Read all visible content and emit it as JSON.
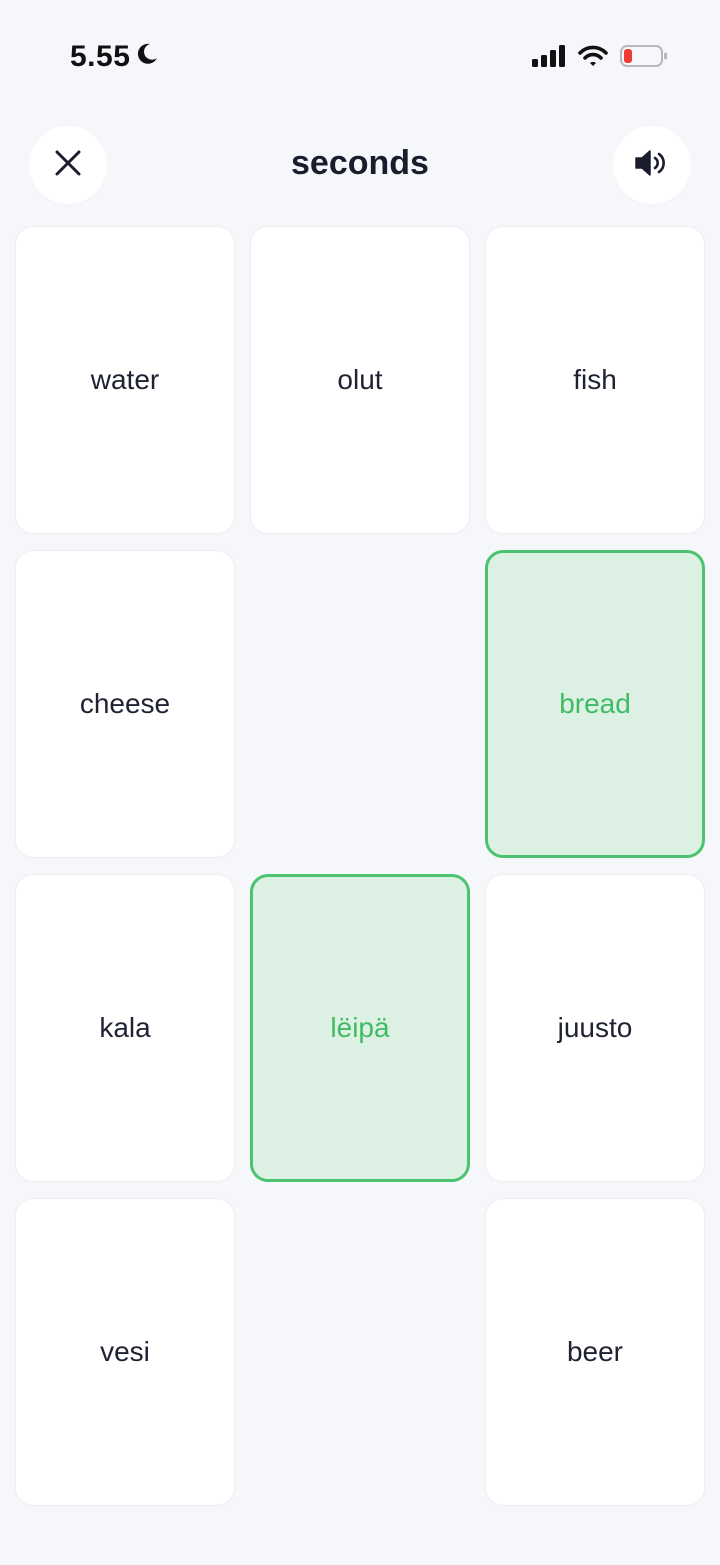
{
  "status_bar": {
    "time": "5.55"
  },
  "header": {
    "title": "seconds"
  },
  "colors": {
    "background": "#f6f7fb",
    "selected_fill": "#dcf1e4",
    "selected_border": "#4cc36f",
    "selected_text": "#3fbc63",
    "battery_low": "#ef3b35"
  },
  "cards": [
    {
      "label": "water",
      "state": "default"
    },
    {
      "label": "olut",
      "state": "default"
    },
    {
      "label": "fish",
      "state": "default"
    },
    {
      "label": "cheese",
      "state": "default"
    },
    {
      "label": "",
      "state": "empty"
    },
    {
      "label": "bread",
      "state": "selected"
    },
    {
      "label": "kala",
      "state": "default"
    },
    {
      "label": "lëipä",
      "state": "selected"
    },
    {
      "label": "juusto",
      "state": "default"
    },
    {
      "label": "vesi",
      "state": "default"
    },
    {
      "label": "",
      "state": "empty"
    },
    {
      "label": "beer",
      "state": "default"
    }
  ]
}
